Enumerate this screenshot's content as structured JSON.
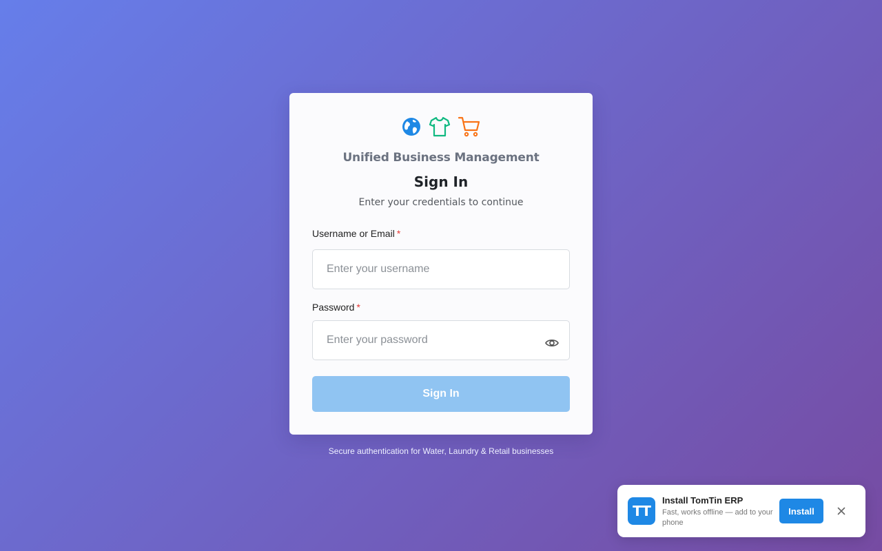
{
  "login": {
    "brand": "Unified Business Management",
    "title": "Sign In",
    "subtitle": "Enter your credentials to continue",
    "username": {
      "label": "Username or Email",
      "required_mark": "*",
      "placeholder": "Enter your username",
      "value": ""
    },
    "password": {
      "label": "Password",
      "required_mark": "*",
      "placeholder": "Enter your password",
      "value": ""
    },
    "submit_label": "Sign In",
    "logo_icons": [
      "globe-icon",
      "shirt-icon",
      "cart-icon"
    ]
  },
  "footer": {
    "text": "Secure authentication for Water, Laundry & Retail businesses"
  },
  "install_prompt": {
    "app_icon_text": "TT",
    "title": "Install TomTin ERP",
    "description": "Fast, works offline — add to your phone",
    "install_label": "Install"
  },
  "colors": {
    "background_start": "#667eea",
    "background_end": "#764ba2",
    "globe": "#1e88e5",
    "shirt": "#10b981",
    "cart": "#f97316",
    "primary": "#1e88e5",
    "submit_disabled": "#90c4f2",
    "required": "#e53935"
  }
}
